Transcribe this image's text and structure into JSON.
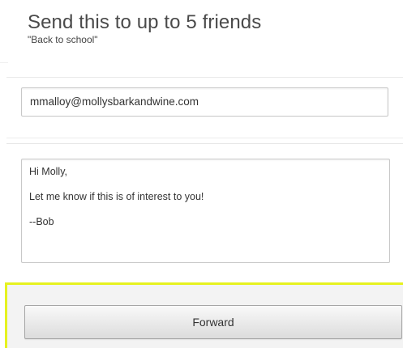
{
  "header": {
    "title": "Send this to up to 5 friends",
    "subtitle": "\"Back to school\""
  },
  "email": {
    "value": "mmalloy@mollysbarkandwine.com"
  },
  "message": {
    "lines": [
      "Hi Molly,",
      "Let me know if this is of interest to you!",
      "--Bob"
    ]
  },
  "actions": {
    "forward_label": "Forward"
  },
  "colors": {
    "highlight": "#e6f21f",
    "button_border": "#a6a6a6",
    "field_border": "#c8c8c8"
  }
}
